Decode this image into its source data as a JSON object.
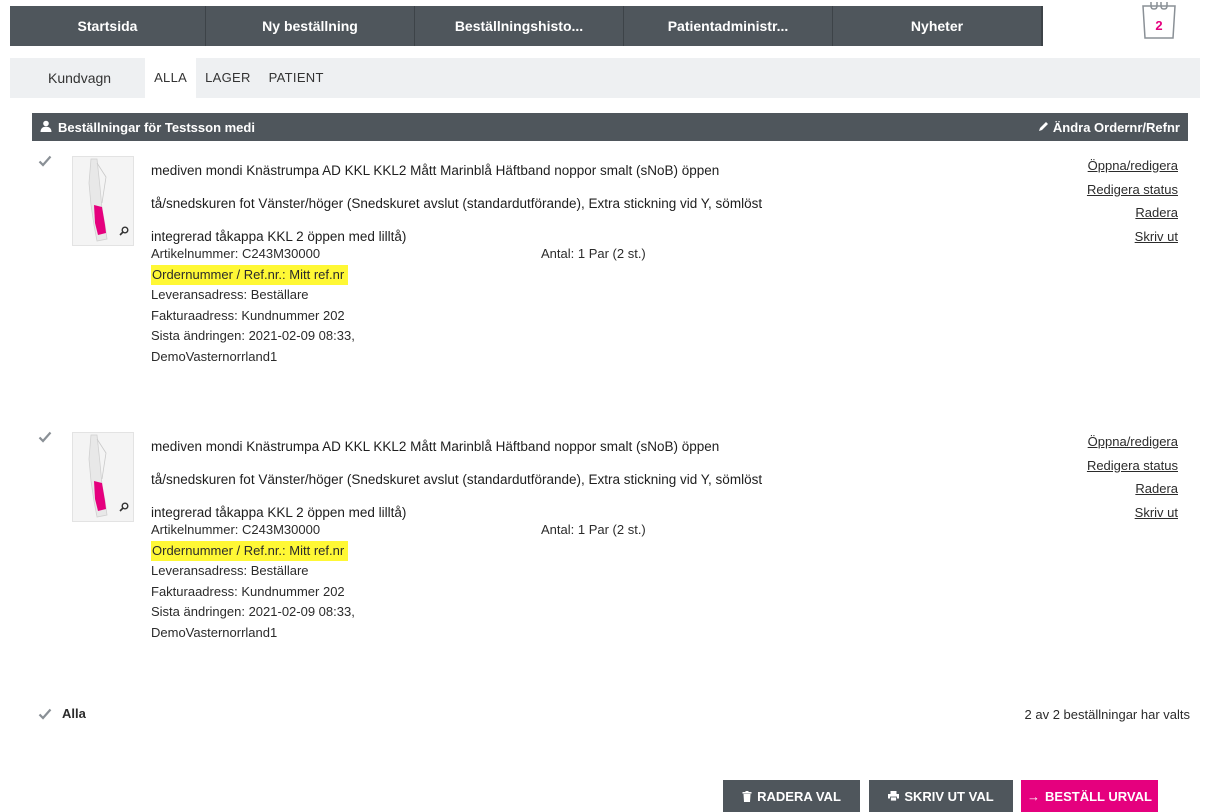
{
  "nav": {
    "items": [
      {
        "label": "Startsida"
      },
      {
        "label": "Ny beställning"
      },
      {
        "label": "Beställningshisto..."
      },
      {
        "label": "Patientadministr..."
      },
      {
        "label": "Nyheter"
      }
    ],
    "cart_count": "2"
  },
  "subnav": {
    "title": "Kundvagn",
    "tabs": [
      {
        "label": "ALLA",
        "active": true
      },
      {
        "label": "LAGER",
        "active": false
      },
      {
        "label": "PATIENT",
        "active": false
      }
    ]
  },
  "orders_bar": {
    "title": "Beställningar för Testsson medi",
    "edit_label": "Ändra Ordernr/Refnr"
  },
  "orders": [
    {
      "checked": true,
      "description_lines": [
        "mediven mondi Knästrumpa AD KKL KKL2 Mått Marinblå Häftband noppor smalt (sNoB) öppen",
        "tå/snedskuren fot Vänster/höger (Snedskuret avslut (standardutförande), Extra stickning vid Y, sömlöst",
        "integrerad tåkappa KKL 2 öppen med lilltå)"
      ],
      "article": "Artikelnummer: C243M30000",
      "quantity": "Antal: 1 Par (2 st.)",
      "order_ref": "Ordernummer / Ref.nr.: Mitt ref.nr",
      "delivery": "Leveransadress: Beställare",
      "invoice": "Fakturaadress: Kundnummer 202",
      "last_change": "Sista ändringen: 2021-02-09 08:33,",
      "last_change_user": "DemoVasternorrland1",
      "actions": {
        "open": "Öppna/redigera",
        "status": "Redigera status",
        "delete": "Radera",
        "print": "Skriv ut"
      }
    },
    {
      "checked": true,
      "description_lines": [
        "mediven mondi Knästrumpa AD KKL KKL2 Mått Marinblå Häftband noppor smalt (sNoB) öppen",
        "tå/snedskuren fot Vänster/höger (Snedskuret avslut (standardutförande), Extra stickning vid Y, sömlöst",
        "integrerad tåkappa KKL 2 öppen med lilltå)"
      ],
      "article": "Artikelnummer: C243M30000",
      "quantity": "Antal: 1 Par (2 st.)",
      "order_ref": "Ordernummer / Ref.nr.: Mitt ref.nr",
      "delivery": "Leveransadress: Beställare",
      "invoice": "Fakturaadress: Kundnummer 202",
      "last_change": "Sista ändringen: 2021-02-09 08:33,",
      "last_change_user": "DemoVasternorrland1",
      "actions": {
        "open": "Öppna/redigera",
        "status": "Redigera status",
        "delete": "Radera",
        "print": "Skriv ut"
      }
    }
  ],
  "footer": {
    "select_all_label": "Alla",
    "selected_count": "2 av 2 beställningar har valts"
  },
  "buttons": {
    "delete_selected": "RADERA VAL",
    "print_selected": "SKRIV UT VAL",
    "order_selected": "BESTÄLL URVAL"
  },
  "colors": {
    "nav_bg": "#4f565c",
    "subnav_bg": "#eef0f2",
    "accent": "#e5007e",
    "highlight": "#fff835"
  },
  "icons": {
    "check": "checkmark-icon",
    "user": "user-icon",
    "edit": "pencil-icon",
    "zoom": "magnifier-icon",
    "trash": "trash-icon",
    "print": "printer-icon",
    "arrow": "arrow-right-icon",
    "cart": "cart-icon"
  }
}
